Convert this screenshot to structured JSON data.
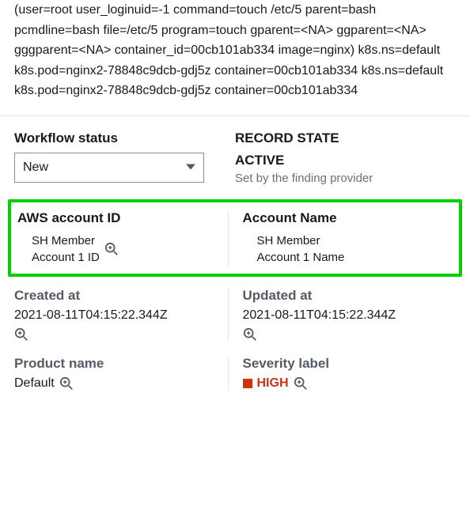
{
  "description": "(user=root user_loginuid=-1 command=touch /etc/5 parent=bash pcmdline=bash file=/etc/5 program=touch gparent=<NA> ggparent=<NA> gggparent=<NA> container_id=00cb101ab334 image=nginx) k8s.ns=default k8s.pod=nginx2-78848c9dcb-gdj5z container=00cb101ab334 k8s.ns=default k8s.pod=nginx2-78848c9dcb-gdj5z container=00cb101ab334",
  "workflow": {
    "label": "Workflow status",
    "selected": "New"
  },
  "recordState": {
    "label": "RECORD STATE",
    "value": "ACTIVE",
    "hint": "Set by the finding provider"
  },
  "account": {
    "idLabel": "AWS account ID",
    "idValue1": "SH Member",
    "idValue2": "Account 1 ID",
    "nameLabel": "Account Name",
    "nameValue1": "SH Member",
    "nameValue2": "Account 1 Name"
  },
  "createdAt": {
    "label": "Created at",
    "value": "2021-08-11T04:15:22.344Z"
  },
  "updatedAt": {
    "label": "Updated at",
    "value": "2021-08-11T04:15:22.344Z"
  },
  "product": {
    "label": "Product name",
    "value": "Default"
  },
  "severity": {
    "label": "Severity label",
    "value": "HIGH",
    "color": "#d13212"
  }
}
